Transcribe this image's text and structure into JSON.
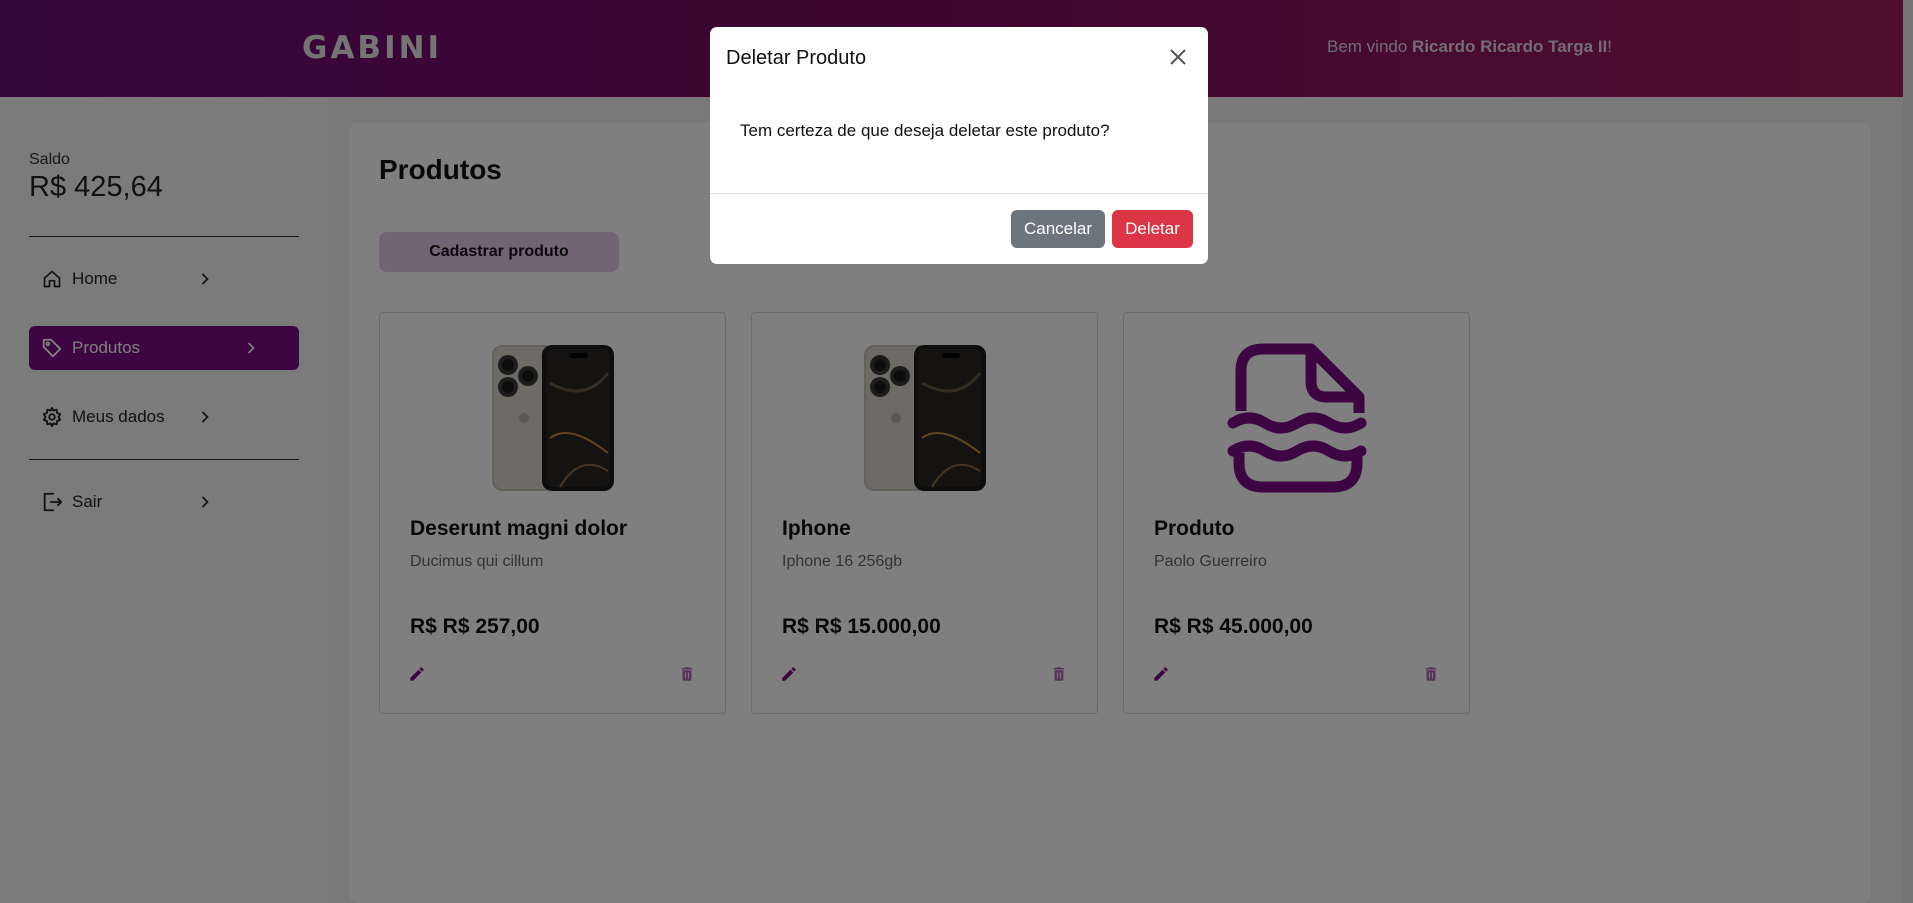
{
  "header": {
    "logo": "GABINI",
    "welcome_prefix": "Bem vindo ",
    "user_name": "Ricardo Ricardo Targa II",
    "welcome_suffix": "!"
  },
  "sidebar": {
    "balance_label": "Saldo",
    "balance_value": "R$ 425,64",
    "items": [
      {
        "label": "Home",
        "icon": "home-icon",
        "active": false
      },
      {
        "label": "Produtos",
        "icon": "tag-icon",
        "active": true
      },
      {
        "label": "Meus dados",
        "icon": "gear-icon",
        "active": false
      },
      {
        "label": "Sair",
        "icon": "logout-icon",
        "active": false
      }
    ]
  },
  "main": {
    "title": "Produtos",
    "add_button": "Cadastrar produto",
    "products": [
      {
        "name": "Deserunt magni dolor",
        "description": "Ducimus qui cillum",
        "price": "R$ R$ 257,00",
        "image": "phone-image"
      },
      {
        "name": "Iphone",
        "description": "Iphone 16 256gb",
        "price": "R$ R$ 15.000,00",
        "image": "phone-image"
      },
      {
        "name": "Produto",
        "description": "Paolo Guerreiro",
        "price": "R$ R$ 45.000,00",
        "image": "placeholder-file-icon"
      }
    ]
  },
  "modal": {
    "title": "Deletar Produto",
    "body": "Tem certeza de que deseja deletar este produto?",
    "cancel_label": "Cancelar",
    "delete_label": "Deletar"
  },
  "colors": {
    "brand_purple": "#7b0c84",
    "header_gradient_end": "#a01d5f",
    "danger": "#dc3545",
    "secondary": "#6c757d"
  }
}
